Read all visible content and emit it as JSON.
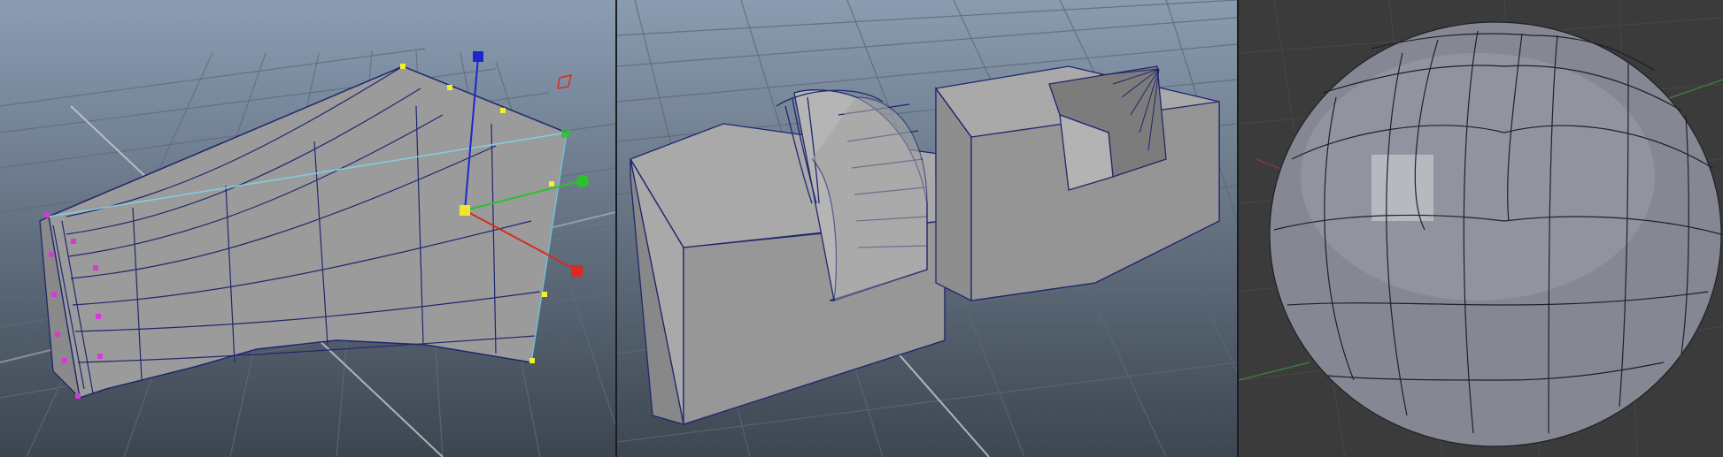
{
  "scene": {
    "viewports": [
      {
        "id": "deformed-mesh-viewport",
        "object": "lofted-mesh",
        "tool": "move-manipulator"
      },
      {
        "id": "boolean-cutout-viewport",
        "object": "boolean-blocks"
      },
      {
        "id": "sphere-viewport",
        "object": "quad-sphere"
      }
    ]
  },
  "colors": {
    "viewport_gradient_top": "#8a9cb3",
    "viewport_gradient_bottom": "#3c4550",
    "dark_viewport_bg": "#3b3b3b",
    "grid_line": "#5f6b78",
    "mesh_face": "#9b9b9b",
    "mesh_edge": "#20266e",
    "sphere_face": "#8e909b",
    "manipulator_x": "#d92b1f",
    "manipulator_y": "#2ec02c",
    "manipulator_z": "#1b28c9",
    "manipulator_center": "#f1e530",
    "selected_vertex": "#d63ad4",
    "handle_vertex": "#f4ee2e"
  }
}
